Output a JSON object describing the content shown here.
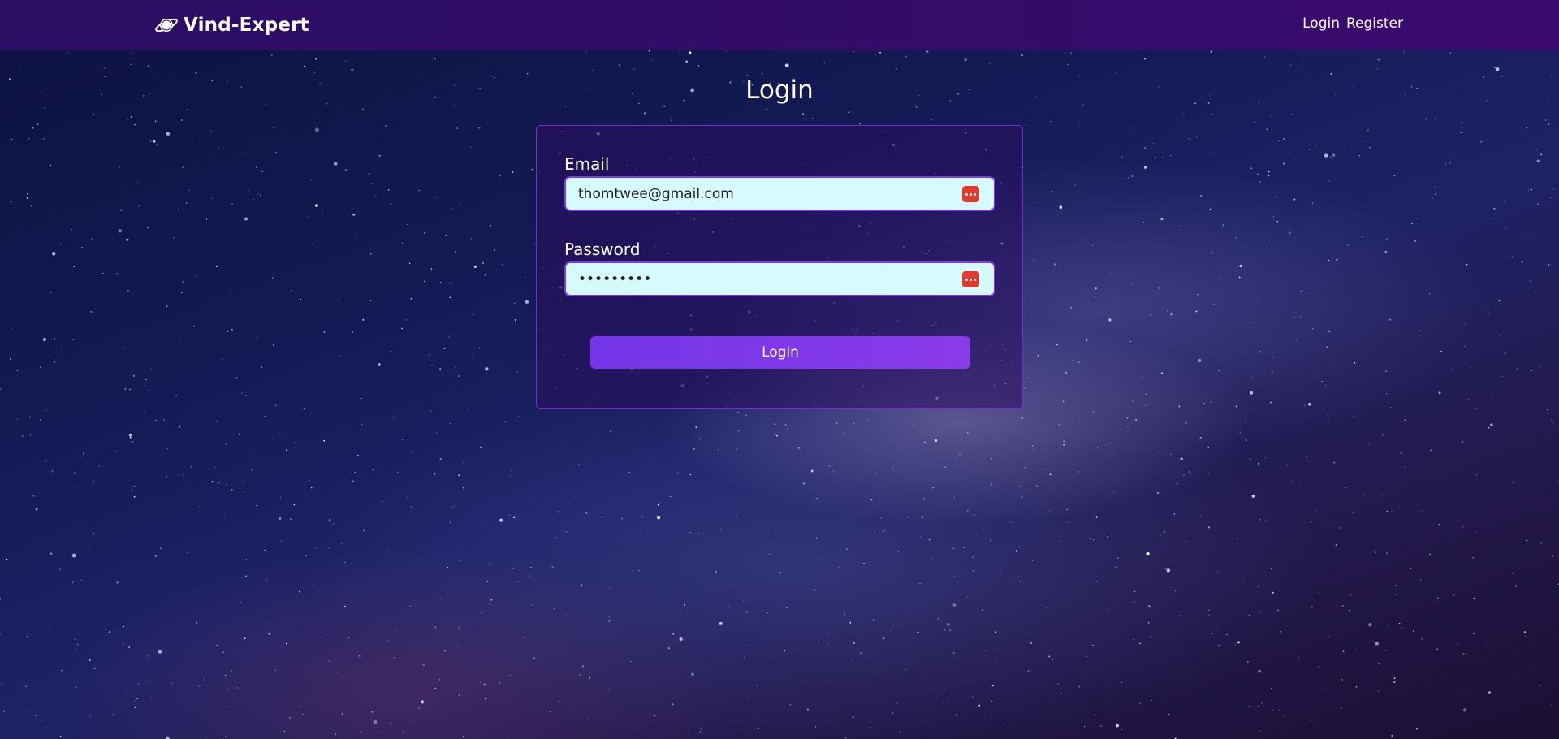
{
  "navbar": {
    "brand": "Vind-Expert",
    "links": [
      {
        "label": "Login"
      },
      {
        "label": "Register"
      }
    ]
  },
  "page": {
    "title": "Login"
  },
  "form": {
    "email_label": "Email",
    "email_value": "thomtwee@gmail.com",
    "password_label": "Password",
    "password_value": "secretpw1",
    "submit_label": "Login"
  },
  "colors": {
    "navbar": "#2a0e63",
    "accent": "#7c3aed",
    "input_bg": "#d6fbff",
    "password_manager_icon": "#e23b2e"
  },
  "icons": {
    "brand": "planet-ring-icon",
    "field_autofill": "password-manager-icon"
  }
}
